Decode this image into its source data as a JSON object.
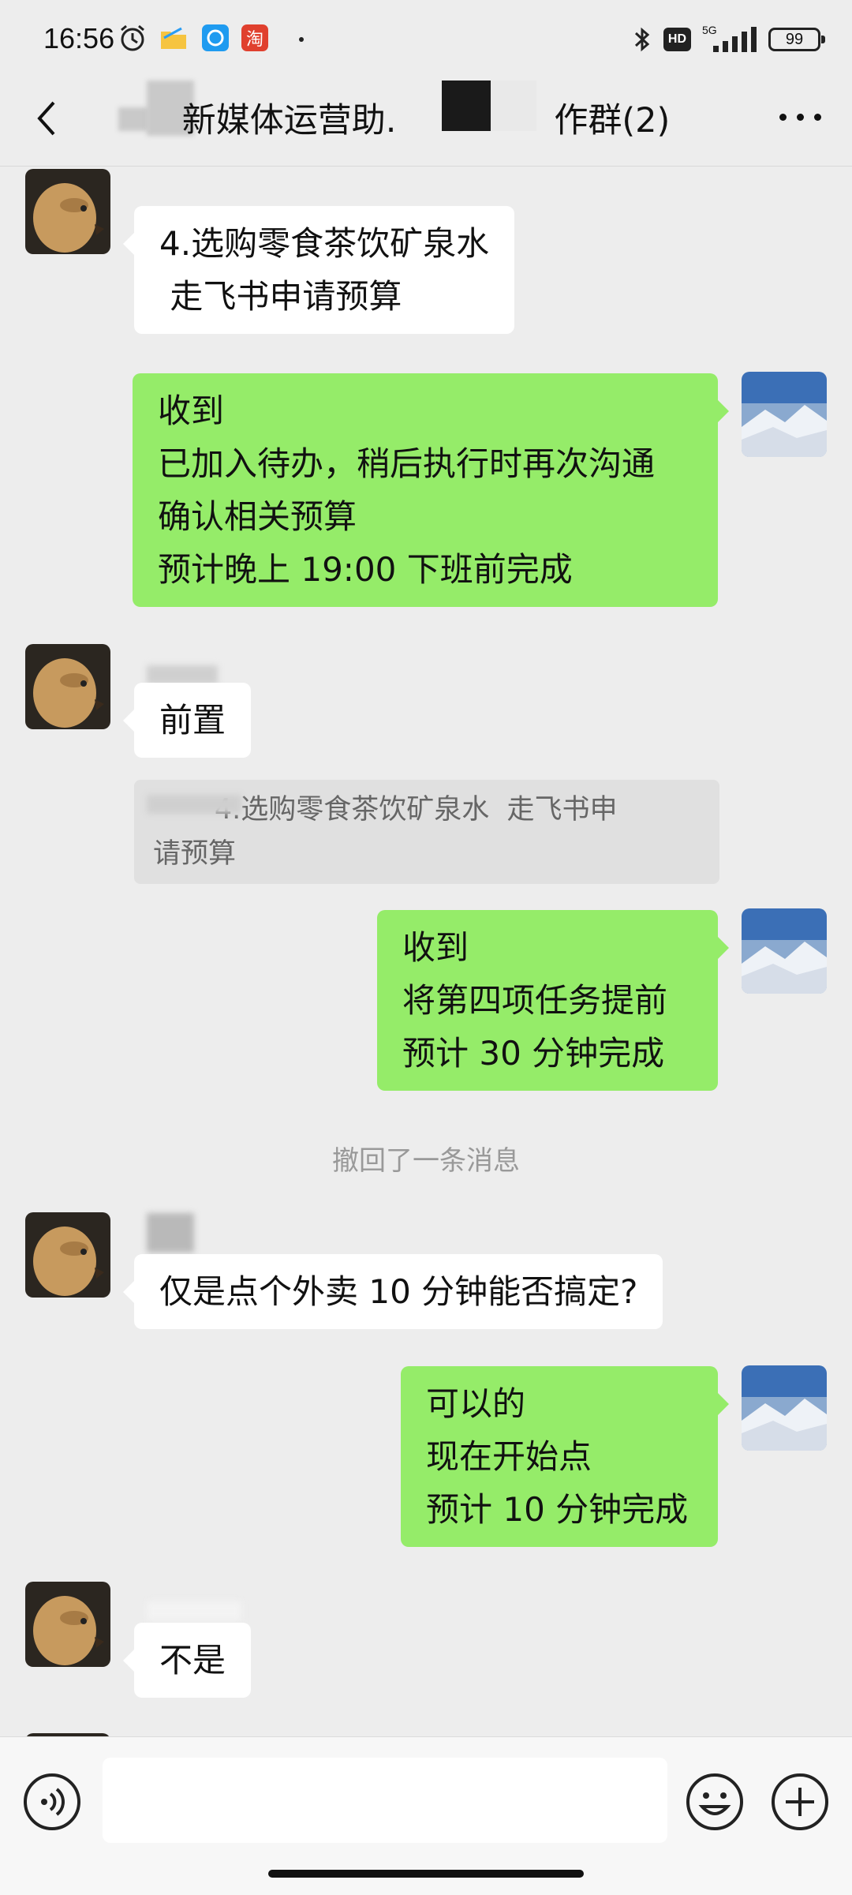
{
  "status_bar": {
    "time": "16:56",
    "hd": "HD",
    "network": "5G",
    "battery": "99",
    "taobao_icon_text": "淘",
    "icons": [
      "alarm-icon",
      "folder-icon",
      "browser-icon",
      "taobao-icon",
      "dot-icon",
      "bluetooth-icon",
      "hd-icon",
      "signal-icon",
      "battery-icon"
    ]
  },
  "header": {
    "title_part1": "新媒体运营助",
    "title_sep": ".",
    "title_part2": "作群(2)"
  },
  "messages": [
    {
      "side": "left",
      "text": "4.选购零食茶饮矿泉水\n 走飞书申请预算"
    },
    {
      "side": "right",
      "text": "收到\n已加入待办，稍后执行时再次沟通\n确认相关预算\n预计晚上 19:00 下班前完成"
    },
    {
      "side": "left",
      "text": "前置",
      "quote": "       4.选购零食茶饮矿泉水  走飞书申\n请预算"
    },
    {
      "side": "right",
      "text": "收到\n将第四项任务提前\n预计 30 分钟完成"
    },
    {
      "side": "system",
      "text": "撤回了一条消息"
    },
    {
      "side": "left",
      "text": "仅是点个外卖 10 分钟能否搞定?"
    },
    {
      "side": "right",
      "text": "可以的\n现在开始点\n预计 10 分钟完成"
    },
    {
      "side": "left",
      "text": "不是"
    }
  ],
  "input_bar": {
    "placeholder": "",
    "icons": [
      "voice-icon",
      "emoji-icon",
      "plus-icon"
    ]
  },
  "colors": {
    "background": "#ededed",
    "sent_bubble": "#95ec69",
    "received_bubble": "#ffffff",
    "quote_bg": "#e0e0e0"
  }
}
